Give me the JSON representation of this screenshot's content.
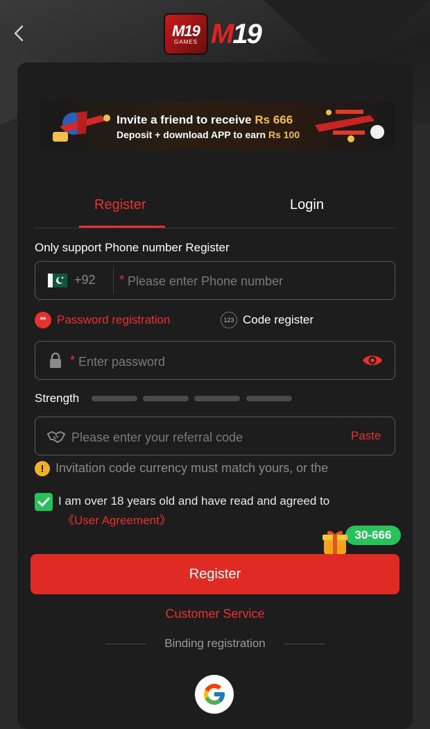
{
  "header": {
    "back_icon": "chevron-left-icon",
    "logo_badge_text": "M19",
    "logo_badge_sub": "GAMES",
    "logo_text_m": "M",
    "logo_text_19": "19"
  },
  "banner": {
    "line1_prefix": "Invite a friend to receive",
    "line1_amount": "Rs 666",
    "line2_prefix": "Deposit + download APP to earn",
    "line2_amount": "Rs 100"
  },
  "tabs": {
    "register": "Register",
    "login": "Login",
    "active": "Register"
  },
  "form": {
    "phone_label": "Only support Phone number Register",
    "country_code": "+92",
    "phone_required": "*",
    "phone_placeholder": "Please enter Phone number",
    "mode_password": "Password registration",
    "mode_password_icon": "**",
    "mode_code": "Code register",
    "mode_code_icon": "123",
    "password_required": "*",
    "password_placeholder": "Enter password",
    "strength_label": "Strength",
    "referral_placeholder": "Please enter your referral code",
    "paste_label": "Paste",
    "warning_icon": "!",
    "warning_text": "Invitation code currency must match yours, or the",
    "agree_text": "I am over 18 years old and have read and agreed to",
    "agreement_link": "《User Agreement》",
    "agree_checked": true,
    "bonus_badge": "30-666",
    "register_button": "Register",
    "customer_service": "Customer Service",
    "binding_registration": "Binding registration"
  },
  "colors": {
    "accent": "#e8322d",
    "green": "#27c25a",
    "card": "#1d1d1d",
    "warn": "#f0b323"
  }
}
